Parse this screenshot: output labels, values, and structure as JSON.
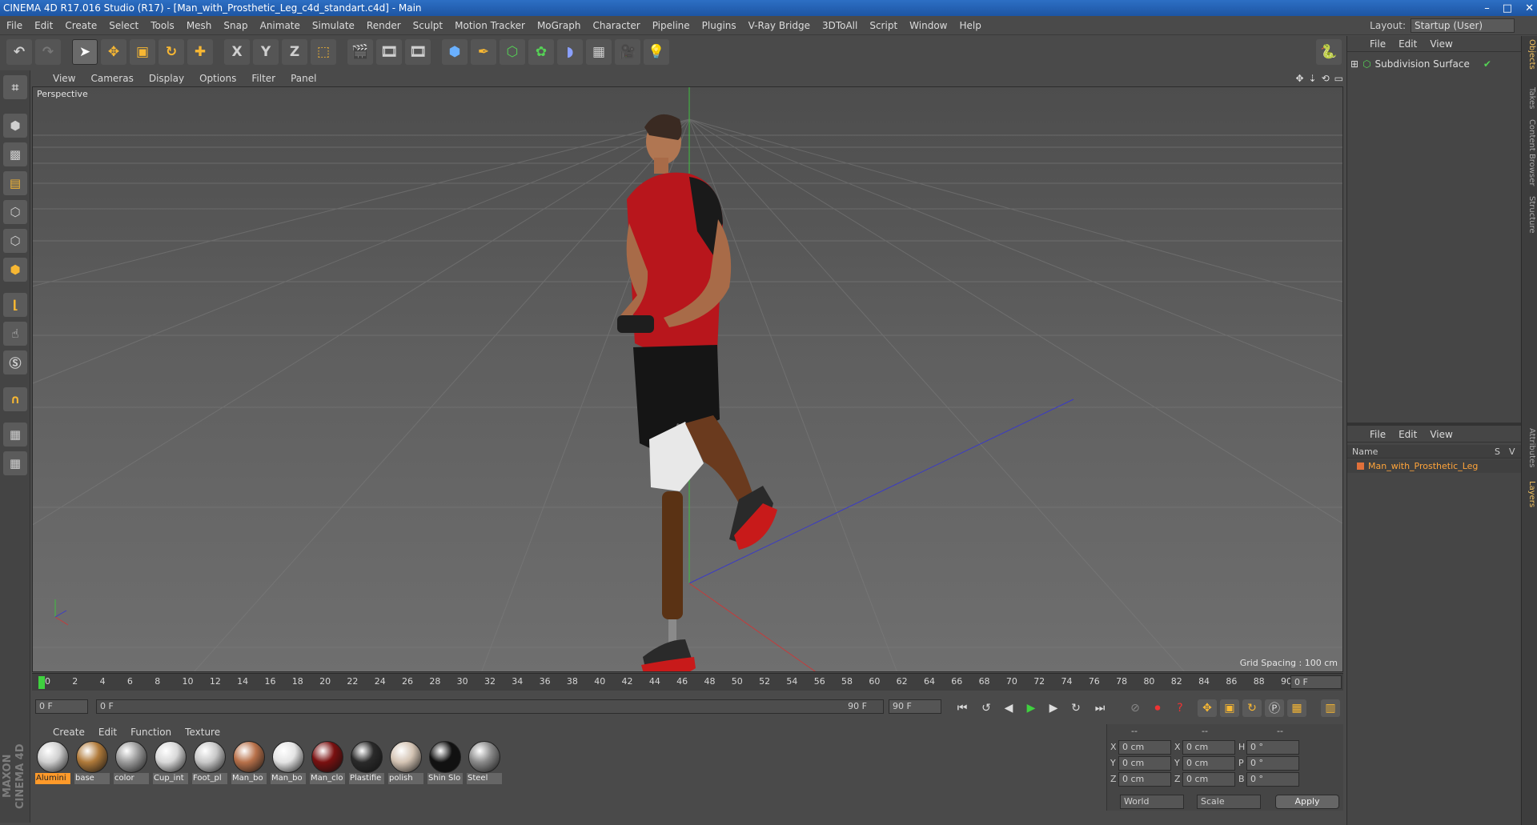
{
  "window": {
    "title": "CINEMA 4D R17.016 Studio (R17) - [Man_with_Prosthetic_Leg_c4d_standart.c4d] - Main",
    "min": "–",
    "max": "□",
    "close": "✕"
  },
  "menu": [
    "File",
    "Edit",
    "Create",
    "Select",
    "Tools",
    "Mesh",
    "Snap",
    "Animate",
    "Simulate",
    "Render",
    "Sculpt",
    "Motion Tracker",
    "MoGraph",
    "Character",
    "Pipeline",
    "Plugins",
    "V-Ray Bridge",
    "3DToAll",
    "Script",
    "Window",
    "Help"
  ],
  "layout": {
    "label": "Layout:",
    "value": "Startup (User)"
  },
  "toolbar": {
    "x": "X",
    "y": "Y",
    "z": "Z"
  },
  "viewport": {
    "menu": [
      "View",
      "Cameras",
      "Display",
      "Options",
      "Filter",
      "Panel"
    ],
    "name": "Perspective",
    "grid_spacing": "Grid Spacing : 100 cm"
  },
  "timeline": {
    "ticks": [
      "0",
      "2",
      "4",
      "6",
      "8",
      "10",
      "12",
      "14",
      "16",
      "18",
      "20",
      "22",
      "24",
      "26",
      "28",
      "30",
      "32",
      "34",
      "36",
      "38",
      "40",
      "42",
      "44",
      "46",
      "48",
      "50",
      "52",
      "54",
      "56",
      "58",
      "60",
      "62",
      "64",
      "66",
      "68",
      "70",
      "72",
      "74",
      "76",
      "78",
      "80",
      "82",
      "84",
      "86",
      "88",
      "90"
    ],
    "current": "0 F",
    "start": "0 F",
    "range_start": "0 F",
    "range_end": "90 F",
    "end": "90 F"
  },
  "materials": {
    "menu": [
      "Create",
      "Edit",
      "Function",
      "Texture"
    ],
    "items": [
      {
        "name": "Alumini",
        "color": "#cfcfcf",
        "selected": true
      },
      {
        "name": "base",
        "color": "#b07a3a"
      },
      {
        "name": "color",
        "color": "#9a9a9a"
      },
      {
        "name": "Cup_int",
        "color": "#d8d8d8"
      },
      {
        "name": "Foot_pl",
        "color": "#c8c8c8"
      },
      {
        "name": "Man_bo",
        "color": "#b8714a"
      },
      {
        "name": "Man_bo",
        "color": "#e4e4e4"
      },
      {
        "name": "Man_clo",
        "color": "#7a1010"
      },
      {
        "name": "Plastifie",
        "color": "#2a2a2a"
      },
      {
        "name": "polish",
        "color": "#d4c4b4"
      },
      {
        "name": "Shin Slo",
        "color": "#111111"
      },
      {
        "name": "Steel",
        "color": "#8a8a8a"
      }
    ]
  },
  "coords": {
    "header": [
      "--",
      "--",
      "--"
    ],
    "rows": [
      {
        "a": "X",
        "av": "0 cm",
        "b": "X",
        "bv": "0 cm",
        "c": "H",
        "cv": "0 °"
      },
      {
        "a": "Y",
        "av": "0 cm",
        "b": "Y",
        "bv": "0 cm",
        "c": "P",
        "cv": "0 °"
      },
      {
        "a": "Z",
        "av": "0 cm",
        "b": "Z",
        "bv": "0 cm",
        "c": "B",
        "cv": "0 °"
      }
    ],
    "world": "World",
    "scale": "Scale",
    "apply": "Apply"
  },
  "objects": {
    "menu": [
      "File",
      "Edit",
      "View"
    ],
    "item": "Subdivision Surface"
  },
  "layers": {
    "menu": [
      "File",
      "Edit",
      "View"
    ],
    "col_name": "Name",
    "col_s": "S",
    "col_v": "V",
    "item": "Man_with_Prosthetic_Leg"
  },
  "right_tabs": [
    "Objects",
    "Takes",
    "Content Browser",
    "Structure",
    "Attributes",
    "Layers"
  ],
  "branding": {
    "text": "MAXON CINEMA 4D"
  }
}
